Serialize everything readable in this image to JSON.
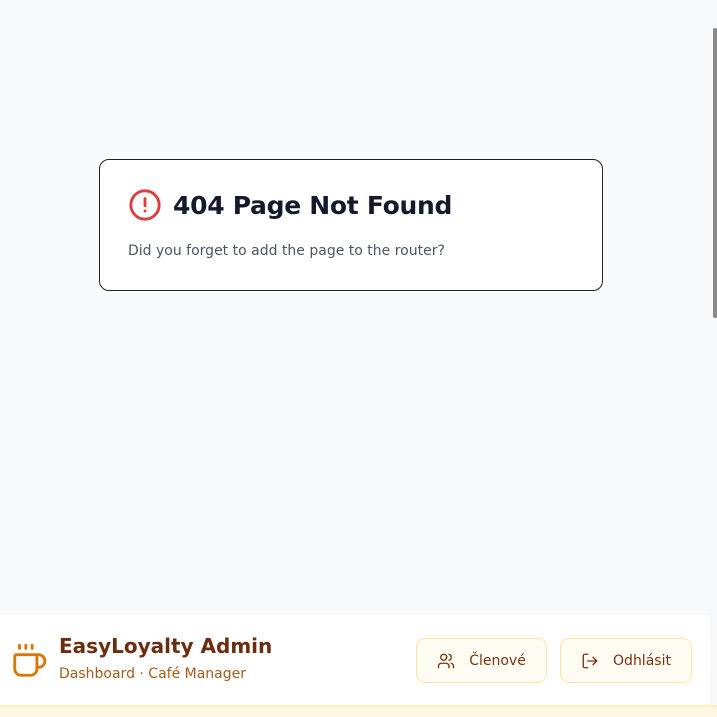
{
  "error_card": {
    "title": "404 Page Not Found",
    "message": "Did you forget to add the page to the router?",
    "icon": "alert-circle-icon",
    "icon_color": "#e03a3a"
  },
  "header": {
    "brand_icon": "coffee-cup-icon",
    "title": "EasyLoyalty Admin",
    "subtitle": "Dashboard · Café Manager",
    "buttons": {
      "members": {
        "label": "Členové",
        "icon": "users-icon"
      },
      "logout": {
        "label": "Odhlásit",
        "icon": "log-out-icon"
      }
    },
    "accent_color": "#d97706",
    "brand_color": "#6b2d0f"
  }
}
